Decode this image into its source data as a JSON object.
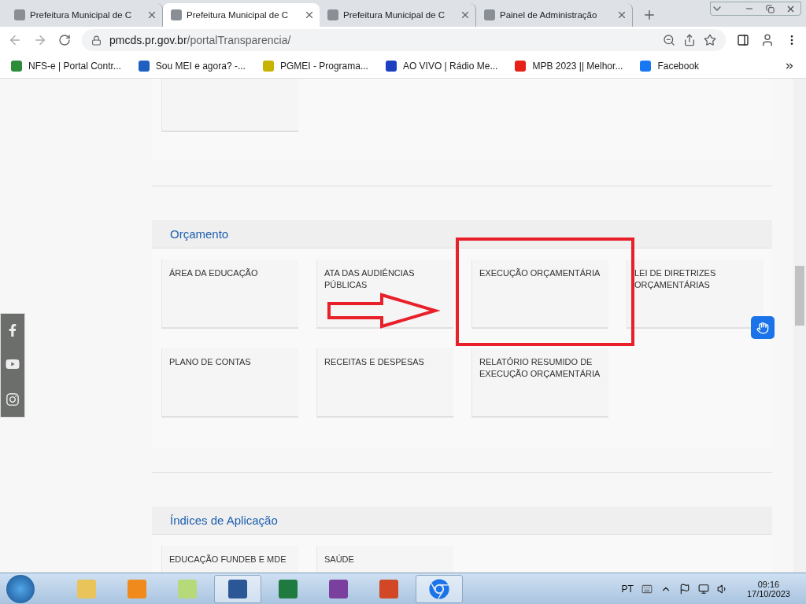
{
  "browser": {
    "tabs": [
      {
        "title": "Prefeitura Municipal de C",
        "selected": false
      },
      {
        "title": "Prefeitura Municipal de C",
        "selected": true
      },
      {
        "title": "Prefeitura Municipal de C",
        "selected": false
      },
      {
        "title": "Painel de Administração",
        "selected": false
      }
    ],
    "url": {
      "host": "pmcds.pr.gov.br",
      "path": "/portalTransparencia/"
    },
    "bookmarks": [
      {
        "label": "NFS-e | Portal Contr...",
        "color": "#2e8b3a"
      },
      {
        "label": "Sou MEI e agora? -...",
        "color": "#1f5fbf"
      },
      {
        "label": "PGMEI - Programa...",
        "color": "#c8b400"
      },
      {
        "label": "AO VIVO | Rádio Me...",
        "color": "#1c3fbf"
      },
      {
        "label": "MPB 2023 || Melhor...",
        "color": "#e62117"
      },
      {
        "label": "Facebook",
        "color": "#1877f2"
      }
    ]
  },
  "page": {
    "sections": [
      {
        "title": "Orçamento",
        "cards": [
          {
            "label": "ÁREA DA EDUCAÇÃO"
          },
          {
            "label": "ATA DAS AUDIÊNCIAS PÚBLICAS"
          },
          {
            "label": "EXECUÇÃO ORÇAMENTÁRIA"
          },
          {
            "label": "LEI DE DIRETRIZES ORÇAMENTÁRIAS"
          },
          {
            "label": "PLANO DE CONTAS"
          },
          {
            "label": "RECEITAS E DESPESAS"
          },
          {
            "label": "RELATÓRIO RESUMIDO DE EXECUÇÃO ORÇAMENTÁRIA"
          }
        ]
      },
      {
        "title": "Índices de Aplicação",
        "cards": [
          {
            "label": "EDUCAÇÃO FUNDEB E MDE"
          },
          {
            "label": "SAÚDE"
          }
        ]
      }
    ]
  },
  "taskbar": {
    "apps": [
      {
        "kind": "explorer",
        "selected": false
      },
      {
        "kind": "media",
        "selected": false
      },
      {
        "kind": "notes",
        "selected": false
      },
      {
        "kind": "word",
        "selected": true
      },
      {
        "kind": "excel",
        "selected": false
      },
      {
        "kind": "onenote",
        "selected": false
      },
      {
        "kind": "powerpoint",
        "selected": false
      },
      {
        "kind": "chrome",
        "selected": true
      }
    ],
    "language": "PT",
    "time": "09:16",
    "date": "17/10/2023"
  }
}
